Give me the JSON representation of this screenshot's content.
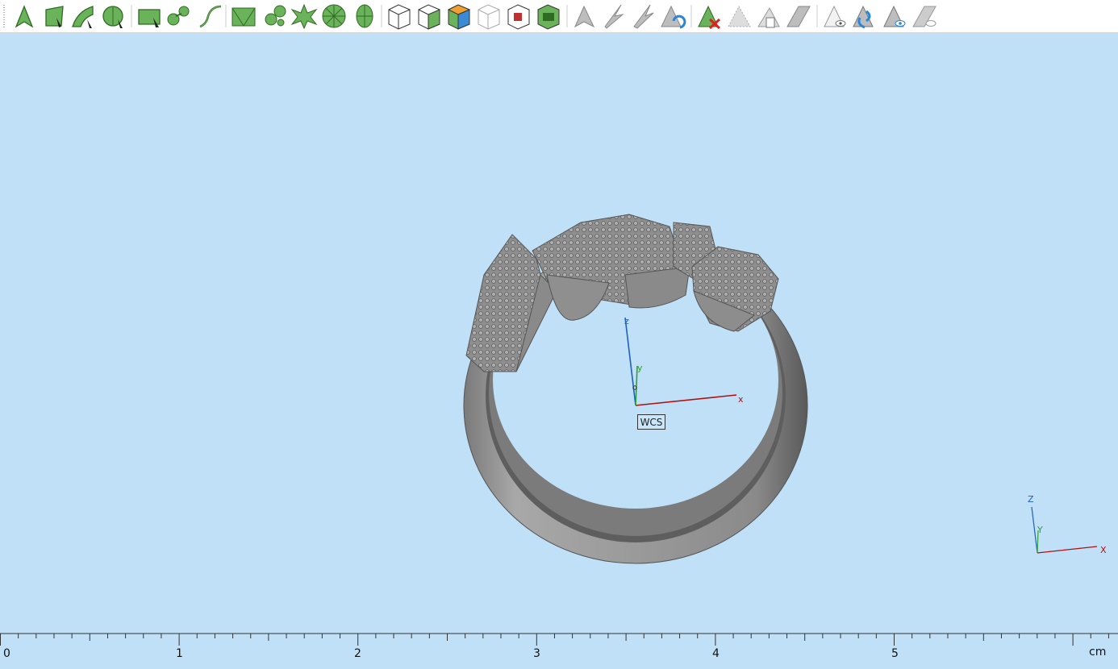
{
  "toolbar": {
    "groups": [
      {
        "name": "selection-modes",
        "tools": [
          {
            "id": "select-vertex",
            "label": "Select Vertex",
            "icon": "vertex-select-icon"
          },
          {
            "id": "select-face",
            "label": "Select Face",
            "icon": "face-select-icon"
          },
          {
            "id": "select-edge",
            "label": "Select Edge",
            "icon": "edge-select-icon"
          },
          {
            "id": "select-solid",
            "label": "Select Solid",
            "icon": "solid-select-icon"
          }
        ]
      },
      {
        "name": "curve-modes",
        "tools": [
          {
            "id": "rect-select",
            "label": "Rectangle Select",
            "icon": "rect-select-icon"
          },
          {
            "id": "blob-select",
            "label": "Blob Select",
            "icon": "blob-select-icon"
          },
          {
            "id": "curve-select",
            "label": "Curve Select",
            "icon": "curve-select-icon"
          }
        ]
      },
      {
        "name": "mesh-modes",
        "tools": [
          {
            "id": "mesh-select",
            "label": "Mesh Select",
            "icon": "mesh-select-icon"
          },
          {
            "id": "cluster-select",
            "label": "Cluster Select",
            "icon": "cluster-select-icon"
          },
          {
            "id": "star-select",
            "label": "Star Select",
            "icon": "star-select-icon"
          },
          {
            "id": "sphere-select",
            "label": "Sphere Select",
            "icon": "sphere-select-icon"
          },
          {
            "id": "radial-select",
            "label": "Radial Select",
            "icon": "radial-select-icon"
          }
        ]
      },
      {
        "name": "box-modes",
        "tools": [
          {
            "id": "box-white",
            "label": "Box Select",
            "icon": "box-icon"
          },
          {
            "id": "box-green",
            "label": "Box Green",
            "icon": "box-green-icon"
          },
          {
            "id": "box-orange",
            "label": "Box Orange",
            "icon": "box-orange-icon"
          },
          {
            "id": "box-outline",
            "label": "Box Outline",
            "icon": "box-outline-icon"
          },
          {
            "id": "box-red",
            "label": "Box Red",
            "icon": "box-red-icon"
          },
          {
            "id": "box-dark",
            "label": "Box Dark",
            "icon": "box-dark-icon"
          }
        ]
      },
      {
        "name": "entity-ops",
        "tools": [
          {
            "id": "gray-arrow",
            "label": "Gray Arrow",
            "icon": "gray-arrow-icon"
          },
          {
            "id": "gray-pick",
            "label": "Gray Pick",
            "icon": "gray-pick-icon"
          },
          {
            "id": "gray-move",
            "label": "Gray Move",
            "icon": "gray-move-icon"
          },
          {
            "id": "refresh",
            "label": "Refresh",
            "icon": "refresh-icon"
          }
        ]
      },
      {
        "name": "delete-ops",
        "tools": [
          {
            "id": "delete",
            "label": "Delete",
            "icon": "delete-icon"
          },
          {
            "id": "hatch",
            "label": "Hatch",
            "icon": "hatch-icon"
          },
          {
            "id": "copy",
            "label": "Copy",
            "icon": "copy-icon"
          },
          {
            "id": "slant",
            "label": "Slant",
            "icon": "slant-icon"
          }
        ]
      },
      {
        "name": "visibility-ops",
        "tools": [
          {
            "id": "eye-gray",
            "label": "Show",
            "icon": "eye-icon"
          },
          {
            "id": "swap-blue",
            "label": "Swap",
            "icon": "swap-icon"
          },
          {
            "id": "eye-blue",
            "label": "Eye Blue",
            "icon": "eye-blue-icon"
          },
          {
            "id": "hide",
            "label": "Hide",
            "icon": "hide-icon"
          }
        ]
      }
    ]
  },
  "viewport": {
    "background": "#bfe0f7",
    "wcs_label": "WCS",
    "axes": {
      "x": "x",
      "y": "y",
      "z": "z"
    },
    "corner_axes": {
      "x": "X",
      "y": "Y",
      "z": "Z"
    }
  },
  "ruler": {
    "ticks": [
      "0",
      "1",
      "2",
      "3",
      "4",
      "5"
    ],
    "unit": "cm"
  }
}
